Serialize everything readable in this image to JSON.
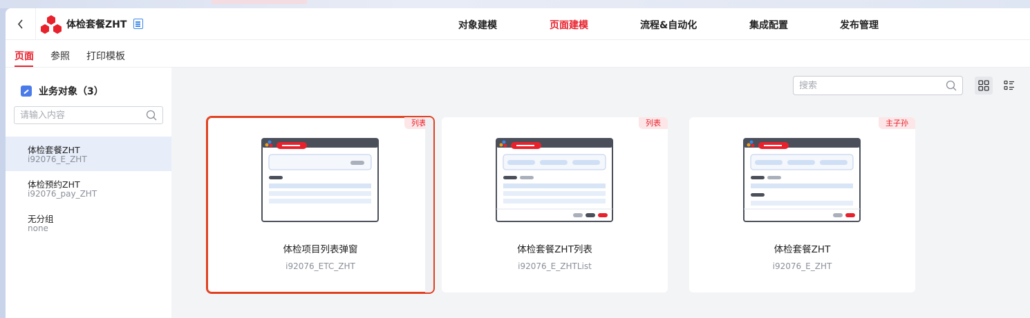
{
  "header": {
    "app_title": "体检套餐ZHT",
    "nav": [
      "对象建模",
      "页面建模",
      "流程&自动化",
      "集成配置",
      "发布管理"
    ],
    "active_nav": "页面建模"
  },
  "subtabs": [
    "页面",
    "参照",
    "打印模板"
  ],
  "sidebar": {
    "title": "业务对象（3）",
    "search_placeholder": "请输入内容",
    "items": [
      {
        "name": "体检套餐ZHT",
        "code": "i92076_E_ZHT"
      },
      {
        "name": "体检预约ZHT",
        "code": "i92076_pay_ZHT"
      },
      {
        "name": "无分组",
        "code": "none"
      }
    ]
  },
  "main": {
    "search_placeholder": "搜索",
    "cards": [
      {
        "tag": "列表",
        "name": "体检项目列表弹窗",
        "code": "i92076_ETC_ZHT"
      },
      {
        "tag": "列表",
        "name": "体检套餐ZHT列表",
        "code": "i92076_E_ZHTList"
      },
      {
        "tag": "主子孙",
        "name": "体检套餐ZHT",
        "code": "i92076_E_ZHT"
      }
    ]
  },
  "colors": {
    "accent": "#e8222d",
    "selected_border": "#e0401f",
    "sidebar_selected": "#e7edf9"
  }
}
